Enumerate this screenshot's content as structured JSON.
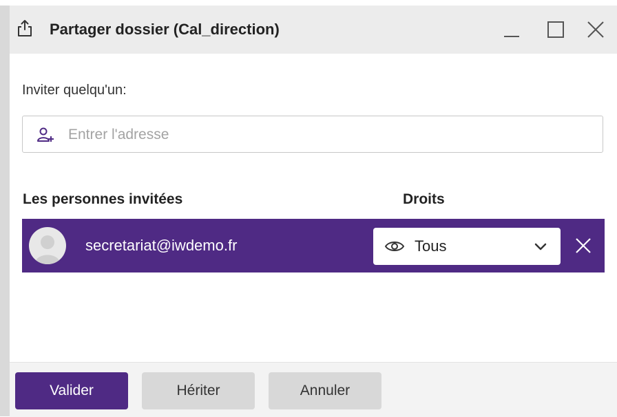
{
  "dialog": {
    "title": "Partager dossier (Cal_direction)",
    "title_icon": "share-icon"
  },
  "window_controls": {
    "minimize_icon": "minimize-icon",
    "maximize_icon": "maximize-icon",
    "close_icon": "close-icon"
  },
  "invite": {
    "label": "Inviter quelqu'un:",
    "placeholder": "Entrer l'adresse",
    "value": "",
    "icon": "add-user-icon"
  },
  "guests": {
    "header_people": "Les personnes invitées",
    "header_rights": "Droits",
    "items": [
      {
        "email": "secretariat@iwdemo.fr",
        "rights": "Tous",
        "rights_icon": "eye-icon"
      }
    ]
  },
  "footer": {
    "validate_label": "Valider",
    "inherit_label": "Hériter",
    "cancel_label": "Annuler"
  },
  "colors": {
    "accent": "#4f2a84",
    "titlebar": "#ececec",
    "secondary_button": "#d8d8d8"
  }
}
